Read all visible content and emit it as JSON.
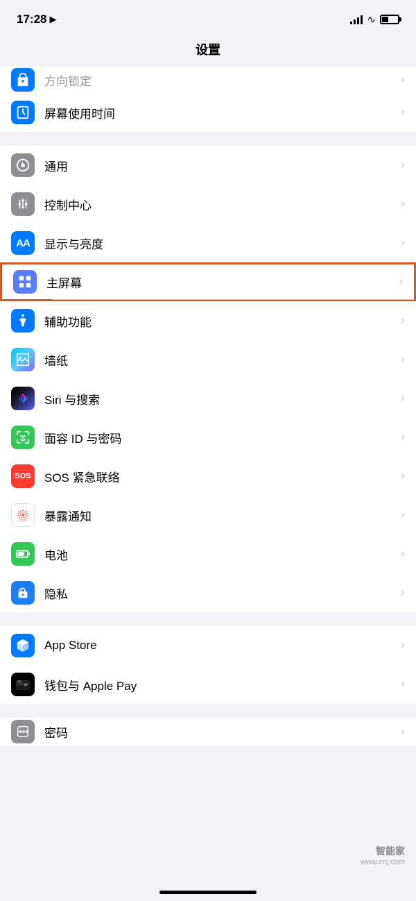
{
  "statusBar": {
    "time": "17:28",
    "locationArrow": "▲"
  },
  "pageTitle": "设置",
  "groups": [
    {
      "id": "group1",
      "items": [
        {
          "id": "screen-time",
          "label": "屏幕使用时间",
          "iconColor": "icon-blue",
          "iconType": "hourglass",
          "partial": false
        }
      ]
    },
    {
      "id": "group2",
      "items": [
        {
          "id": "general",
          "label": "通用",
          "iconColor": "icon-gray",
          "iconType": "gear"
        },
        {
          "id": "control-center",
          "label": "控制中心",
          "iconColor": "icon-gray",
          "iconType": "sliders"
        },
        {
          "id": "display",
          "label": "显示与亮度",
          "iconColor": "icon-blue",
          "iconType": "aa"
        },
        {
          "id": "home-screen",
          "label": "主屏幕",
          "iconColor": "icon-blue",
          "iconType": "grid",
          "highlighted": true
        },
        {
          "id": "accessibility",
          "label": "辅助功能",
          "iconColor": "icon-blue",
          "iconType": "accessibility"
        },
        {
          "id": "wallpaper",
          "label": "墙纸",
          "iconColor": "icon-teal",
          "iconType": "flower"
        },
        {
          "id": "siri",
          "label": "Siri 与搜索",
          "iconColor": "icon-dark-blue",
          "iconType": "siri"
        },
        {
          "id": "face-id",
          "label": "面容 ID 与密码",
          "iconColor": "icon-green",
          "iconType": "face-id"
        },
        {
          "id": "sos",
          "label": "SOS 紧急联络",
          "iconColor": "icon-sos-red",
          "iconType": "sos"
        },
        {
          "id": "exposure",
          "label": "暴露通知",
          "iconColor": "icon-red",
          "iconType": "exposure"
        },
        {
          "id": "battery",
          "label": "电池",
          "iconColor": "icon-green",
          "iconType": "battery"
        },
        {
          "id": "privacy",
          "label": "隐私",
          "iconColor": "icon-blue2",
          "iconType": "hand"
        }
      ]
    },
    {
      "id": "group3",
      "items": [
        {
          "id": "app-store",
          "label": "App Store",
          "iconColor": "icon-blue",
          "iconType": "appstore"
        },
        {
          "id": "wallet",
          "label": "钱包与 Apple Pay",
          "iconColor": "icon-dark-blue",
          "iconType": "wallet"
        }
      ]
    },
    {
      "id": "group4",
      "items": [
        {
          "id": "passwords",
          "label": "密码",
          "iconColor": "icon-gray",
          "iconType": "password",
          "partial": true
        }
      ]
    }
  ],
  "watermark": {
    "top": "智能家",
    "bottom": "www.znj.com"
  },
  "homeIndicator": true
}
